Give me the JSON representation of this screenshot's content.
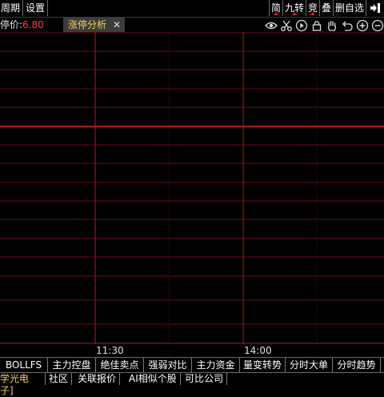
{
  "menu": {
    "items": [
      "周期",
      "设置"
    ]
  },
  "toolbar": {
    "simple": "简",
    "nine": "九转",
    "auction": "竞",
    "overlay": "叠",
    "delete_self": "删自选",
    "exit_icon": "exit-icon"
  },
  "info": {
    "limit_label": "停价:",
    "limit_value": "6.80",
    "tab_title": "涨停分析",
    "tab_close": "✕"
  },
  "chart_icons": [
    "eye-icon",
    "scissors-icon",
    "play-circle-icon",
    "lock-icon",
    "hand-icon",
    "undo-icon",
    "zoom-in-icon",
    "zoom-out-icon"
  ],
  "colors": {
    "grid": "#6a0f14",
    "grid_bright": "#b01820",
    "limit": "#ff3b3b",
    "tab_text": "#f0d060",
    "background": "#000000"
  },
  "axis": {
    "time_1": "11:30",
    "time_2": "14:00"
  },
  "indicators": [
    "BOLLFS",
    "主力控盘",
    "绝佳卖点",
    "强弱对比",
    "主力资金",
    "量变转势",
    "分时大单",
    "分时趋势"
  ],
  "bottom": {
    "stock": "学光电子]",
    "links": [
      "社区",
      "关联报价",
      "AI相似个股",
      "可比公司"
    ]
  }
}
